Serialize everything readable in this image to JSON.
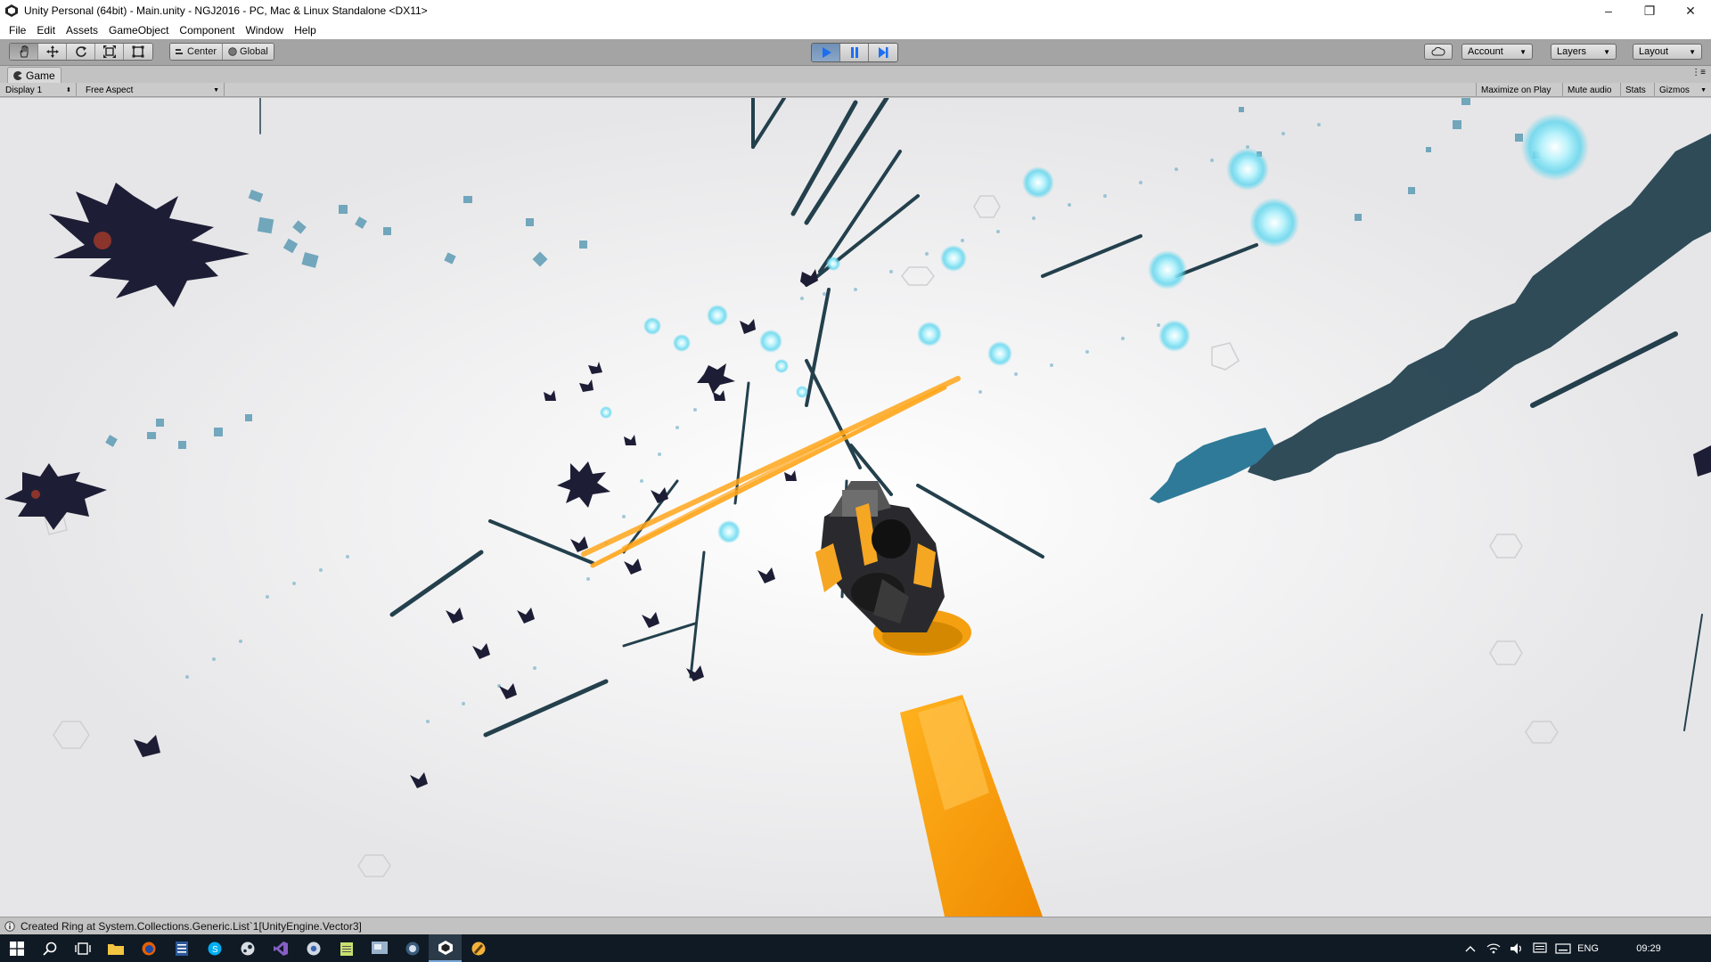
{
  "window": {
    "title": "Unity Personal (64bit) - Main.unity - NGJ2016 - PC, Mac & Linux Standalone <DX11>",
    "controls": [
      "–",
      "❐",
      "✕"
    ]
  },
  "menu": [
    "File",
    "Edit",
    "Assets",
    "GameObject",
    "Component",
    "Window",
    "Help"
  ],
  "toolbar": {
    "transform_tools": [
      "hand-icon",
      "move-icon",
      "rotate-icon",
      "scale-icon",
      "rect-icon"
    ],
    "pivot_label": "Center",
    "space_label": "Global",
    "playback": [
      "play-icon",
      "pause-icon",
      "step-icon"
    ],
    "cloud_icon": "cloud-icon",
    "account_label": "Account",
    "layers_label": "Layers",
    "layout_label": "Layout"
  },
  "game_tab": {
    "label": "Game",
    "display_label": "Display 1",
    "aspect_label": "Free Aspect",
    "maximize_label": "Maximize on Play",
    "mute_label": "Mute audio",
    "stats_label": "Stats",
    "gizmos_label": "Gizmos"
  },
  "status": {
    "message": "Created Ring at System.Collections.Generic.List`1[UnityEngine.Vector3]"
  },
  "taskbar": {
    "apps": [
      "windows-start-icon",
      "search-icon",
      "task-view-icon",
      "file-explorer-icon",
      "firefox-icon",
      "calculator-icon",
      "skype-icon",
      "steam-icon",
      "visual-studio-icon",
      "chrome-icon",
      "notepad-icon",
      "paint-icon",
      "obs-icon",
      "unity-icon",
      "paint-net-icon"
    ],
    "active_app": "unity-icon",
    "language": "ENG",
    "time": "09:29"
  },
  "colors": {
    "viewport_bg": "#e6e6e8",
    "enemy_dark": "#1d1e35",
    "laser": "#ffa61a",
    "orb": "#7fe4f5",
    "streak": "#1f4450"
  }
}
